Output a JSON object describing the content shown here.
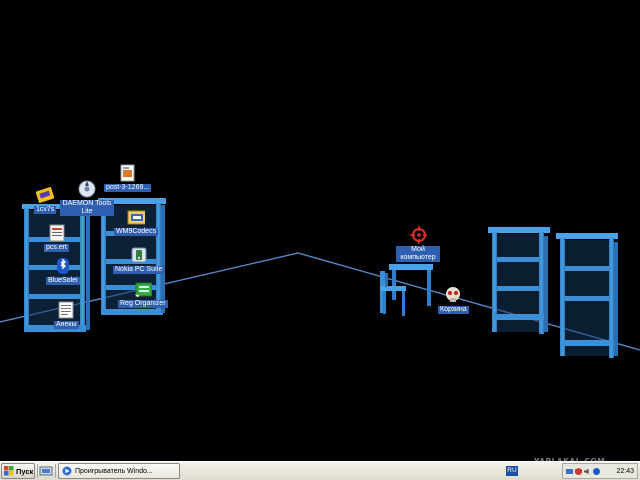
{
  "desktop": {
    "icons": [
      {
        "label": "1cv7s"
      },
      {
        "label": "DAEMON Tools Lite"
      },
      {
        "label": "post-3-1269..."
      },
      {
        "label": "pcs.ert"
      },
      {
        "label": "WM9Codecs"
      },
      {
        "label": "BlueSolei"
      },
      {
        "label": "Nokia PC Suite"
      },
      {
        "label": "Reg Organizer"
      },
      {
        "label": "Анекы"
      },
      {
        "label": "Мой компьютер"
      },
      {
        "label": "Корзина"
      }
    ]
  },
  "taskbar": {
    "start_label": "Пуск",
    "task_label": "Проигрыватель Windo...",
    "language": "RU",
    "clock": "22:43"
  },
  "watermark": "YAPLAKAL.COM",
  "colors": {
    "shelf_blue": "#3a8fd6",
    "floor_line": "#5a86c9",
    "label_bg": "#2f5fb0"
  }
}
